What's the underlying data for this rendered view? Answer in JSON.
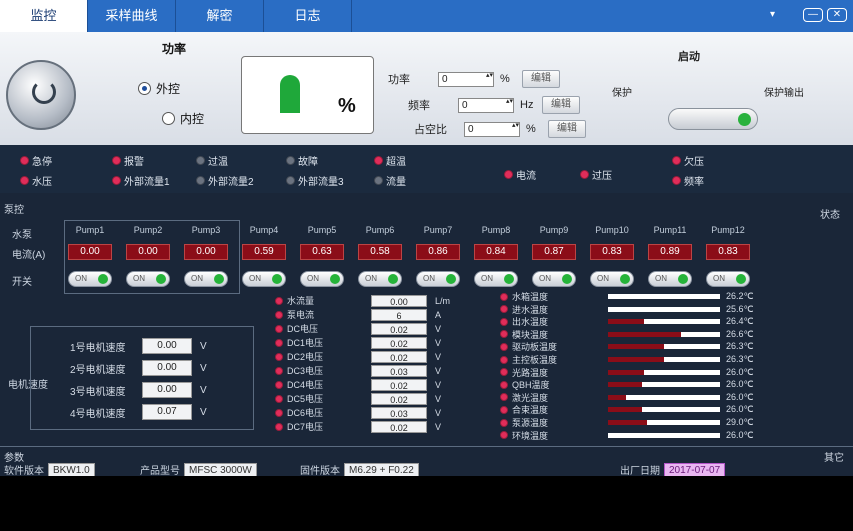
{
  "tabs": [
    {
      "label": "监控",
      "active": true
    },
    {
      "label": "采样曲线",
      "active": false
    },
    {
      "label": "解密",
      "active": false
    },
    {
      "label": "日志",
      "active": false
    }
  ],
  "window": {
    "dropdown": "▾",
    "minimize": "—",
    "close": "✕"
  },
  "power": {
    "title": "功率",
    "external_label": "外控",
    "internal_label": "内控",
    "gauge_value": "%",
    "gauge_fraction": 0.25,
    "rows": [
      {
        "label": "功率",
        "value": "0",
        "unit": "%",
        "button": "编辑"
      },
      {
        "label": "频率",
        "value": "0",
        "unit": "Hz",
        "button": "编辑"
      },
      {
        "label": "占空比",
        "value": "0",
        "unit": "%",
        "button": "编辑"
      }
    ]
  },
  "top_right": {
    "title": "启动",
    "label_left": "保护",
    "label_right": "保护输出"
  },
  "lights_row1": [
    "急停",
    "报警",
    "过温",
    "故障",
    "超温",
    "电流",
    "过压",
    "欠压",
    "频率"
  ],
  "lights_row2": [
    "水压",
    "外部流量1",
    "外部流量2",
    "外部流量3",
    "流量"
  ],
  "panel_labels": {
    "left_top": "泵控",
    "right_top": "状态",
    "motor": "电机速度",
    "bottom_left": "参数",
    "bottom_right": "其它"
  },
  "pump_row_labels": {
    "header": "水泵",
    "current": "电流(A)",
    "switch": "开关"
  },
  "pumps": [
    {
      "name": "Pump1",
      "value": "0.00"
    },
    {
      "name": "Pump2",
      "value": "0.00"
    },
    {
      "name": "Pump3",
      "value": "0.00"
    },
    {
      "name": "Pump4",
      "value": "0.59"
    },
    {
      "name": "Pump5",
      "value": "0.63"
    },
    {
      "name": "Pump6",
      "value": "0.58"
    },
    {
      "name": "Pump7",
      "value": "0.86"
    },
    {
      "name": "Pump8",
      "value": "0.84"
    },
    {
      "name": "Pump9",
      "value": "0.87"
    },
    {
      "name": "Pump10",
      "value": "0.83"
    },
    {
      "name": "Pump11",
      "value": "0.89"
    },
    {
      "name": "Pump12",
      "value": "0.83"
    }
  ],
  "switch_label": "ON",
  "speeds": [
    {
      "label": "1号电机速度",
      "value": "0.00",
      "unit": "V"
    },
    {
      "label": "2号电机速度",
      "value": "0.00",
      "unit": "V"
    },
    {
      "label": "3号电机速度",
      "value": "0.00",
      "unit": "V"
    },
    {
      "label": "4号电机速度",
      "value": "0.07",
      "unit": "V"
    }
  ],
  "readings": [
    {
      "name": "水流量",
      "value": "0.00",
      "unit": "L/m"
    },
    {
      "name": "泵电流",
      "value": "6",
      "unit": "A"
    },
    {
      "name": "DC电压",
      "value": "0.02",
      "unit": "V"
    },
    {
      "name": "DC1电压",
      "value": "0.02",
      "unit": "V"
    },
    {
      "name": "DC2电压",
      "value": "0.02",
      "unit": "V"
    },
    {
      "name": "DC3电压",
      "value": "0.03",
      "unit": "V"
    },
    {
      "name": "DC4电压",
      "value": "0.02",
      "unit": "V"
    },
    {
      "name": "DC5电压",
      "value": "0.02",
      "unit": "V"
    },
    {
      "name": "DC6电压",
      "value": "0.03",
      "unit": "V"
    },
    {
      "name": "DC7电压",
      "value": "0.02",
      "unit": "V"
    }
  ],
  "temps": [
    {
      "name": "水箱温度",
      "value": "26.2℃",
      "fill": 0.0
    },
    {
      "name": "进水温度",
      "value": "25.6℃",
      "fill": 0.0
    },
    {
      "name": "出水温度",
      "value": "26.4℃",
      "fill": 0.32
    },
    {
      "name": "模块温度",
      "value": "26.6℃",
      "fill": 0.65
    },
    {
      "name": "驱动板温度",
      "value": "26.3℃",
      "fill": 0.5
    },
    {
      "name": "主控板温度",
      "value": "26.3℃",
      "fill": 0.5
    },
    {
      "name": "光路温度",
      "value": "26.0℃",
      "fill": 0.32
    },
    {
      "name": "QBH温度",
      "value": "26.0℃",
      "fill": 0.3
    },
    {
      "name": "激光温度",
      "value": "26.0℃",
      "fill": 0.16
    },
    {
      "name": "合束温度",
      "value": "26.0℃",
      "fill": 0.3
    },
    {
      "name": "泵源温度",
      "value": "29.0℃",
      "fill": 0.35
    },
    {
      "name": "环境温度",
      "value": "26.0℃",
      "fill": 0.0
    }
  ],
  "info": {
    "version_label": "软件版本",
    "version": "BKW1.0",
    "model_label": "产品型号",
    "model": "MFSC 3000W",
    "firmware_label": "固件版本",
    "firmware": "M6.29 + F0.22",
    "date_label": "出厂日期",
    "date": "2017-07-07"
  }
}
